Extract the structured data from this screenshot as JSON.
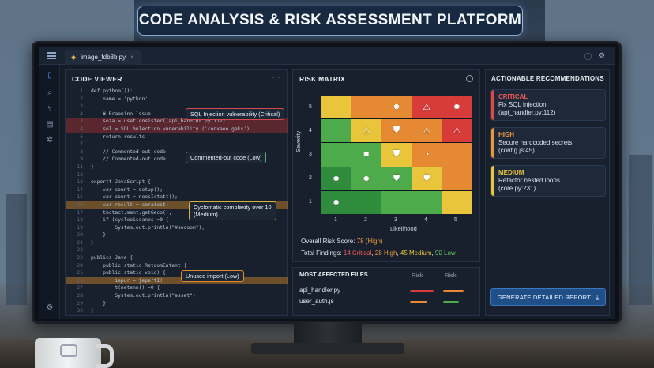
{
  "banner": {
    "title": "CODE ANALYSIS & RISK ASSESSMENT PLATFORM"
  },
  "tabbar": {
    "file_tab": "image_fdb8b.py",
    "close_glyph": "×"
  },
  "icons": {
    "menu": "hamburger-icon",
    "help": "help-icon",
    "settings": "gear-icon",
    "explorer": "file-icon",
    "search": "search-icon",
    "branch": "git-branch-icon",
    "book": "book-icon",
    "debug": "bug-icon",
    "more": "more-dots-icon",
    "download": "download-icon"
  },
  "code_viewer": {
    "title": "CODE VIEWER",
    "more": "···",
    "lines": [
      {
        "n": "1",
        "t": "def pythom()):"
      },
      {
        "n": "2",
        "t": "    name = 'python'"
      },
      {
        "n": "3",
        "t": ""
      },
      {
        "n": "4",
        "t": "    # Braenino lssue"
      },
      {
        "n": "3",
        "t": "    soza = uset.cosister((api_handler.py:112)",
        "hl": "red"
      },
      {
        "n": "4",
        "t": "    sol = SQL hnlection vunerability ('conxaoe gaks')",
        "hl": "red"
      },
      {
        "n": "6",
        "t": "    return results"
      },
      {
        "n": "7",
        "t": ""
      },
      {
        "n": "8",
        "t": "    // Commented-out code"
      },
      {
        "n": "9",
        "t": "    // Commented-out code"
      },
      {
        "n": "11",
        "t": "}"
      },
      {
        "n": "12",
        "t": ""
      },
      {
        "n": "13",
        "t": "exportt JavaScript {"
      },
      {
        "n": "14",
        "t": "    var count = setup();"
      },
      {
        "n": "15",
        "t": "    var count = neesIctatt();"
      },
      {
        "n": "16",
        "t": "    var result = coraiest)",
        "hl": "orange"
      },
      {
        "n": "17",
        "t": "    tnctact.mant.getGeco();"
      },
      {
        "n": "18",
        "t": "    if (cycleeiscanes =0 {"
      },
      {
        "n": "19",
        "t": "        System.out.println(\"#secoom\");"
      },
      {
        "n": "20",
        "t": "    }"
      },
      {
        "n": "21",
        "t": "}"
      },
      {
        "n": "22",
        "t": ""
      },
      {
        "n": "23",
        "t": "publics Java {"
      },
      {
        "n": "24",
        "t": "    public static RetoomEntent {"
      },
      {
        "n": "25",
        "t": "    public static void) {"
      },
      {
        "n": "28",
        "t": "        iepur = jepertI(",
        "hl": "orange"
      },
      {
        "n": "27",
        "t": "        t(netenn() =0 {"
      },
      {
        "n": "28",
        "t": "        System.out.println(\"asset\");"
      },
      {
        "n": "29",
        "t": "    }"
      },
      {
        "n": "30",
        "t": "}"
      }
    ],
    "callouts": {
      "sql": "SQL Injection vulnerability (Critical)",
      "commented": "Commented-out code (Low)",
      "complexity_1": "Cyclomatic complexity over 10",
      "complexity_2": "(Medium)",
      "unused": "Unused import (Low)"
    }
  },
  "risk_matrix": {
    "title": "RISK MATRIX",
    "y_axis": "Severity",
    "x_axis": "Likelihood",
    "y_ticks": [
      "5",
      "4",
      "3",
      "2",
      "1"
    ],
    "x_ticks": [
      "1",
      "2",
      "3",
      "4",
      "5"
    ],
    "score_label": "Overall Risk Score: ",
    "score_value": "78 (High)",
    "findings_label": "Total Findings: ",
    "findings_critical": "14 Critical",
    "findings_high": "28 High",
    "findings_medium": "45 Medium",
    "findings_low": "90 Low",
    "sep": ", "
  },
  "chart_data": {
    "type": "heatmap",
    "title": "RISK MATRIX",
    "xlabel": "Likelihood",
    "ylabel": "Severity",
    "x": [
      1,
      2,
      3,
      4,
      5
    ],
    "y": [
      5,
      4,
      3,
      2,
      1
    ],
    "cells": [
      [
        "yellow",
        "orange",
        "orange",
        "red",
        "red"
      ],
      [
        "green",
        "yellow",
        "orange",
        "orange",
        "red"
      ],
      [
        "green",
        "green",
        "yellow",
        "orange",
        "orange"
      ],
      [
        "dgreen",
        "green",
        "green",
        "yellow",
        "orange"
      ],
      [
        "dgreen",
        "dgreen",
        "green",
        "green",
        "yellow"
      ]
    ],
    "markers": [
      [
        "",
        "",
        "gear",
        "warning",
        "gear"
      ],
      [
        "",
        "warning",
        "shield",
        "warning",
        "warning"
      ],
      [
        "",
        "gear",
        "shield",
        "clock",
        ""
      ],
      [
        "gear",
        "gear",
        "shield",
        "shield",
        ""
      ],
      [
        "gear",
        "",
        "",
        "",
        ""
      ]
    ]
  },
  "files": {
    "title": "MOST AFFECTED FILES",
    "col1": "Risk",
    "col2": "Risk",
    "items": [
      {
        "name": "api_handler.py"
      },
      {
        "name": "user_auth.js"
      }
    ]
  },
  "recommendations": {
    "title": "ACTIONABLE RECOMMENDATIONS",
    "items": [
      {
        "level": "CRITICAL",
        "line1": "Fix SQL Injection",
        "line2": "(api_handler.py:112)"
      },
      {
        "level": "HIGH",
        "line1": "Secure hardcoded secrets",
        "line2": "(config.js:45)"
      },
      {
        "level": "MEDIUM",
        "line1": "Refactor nested loops",
        "line2": "(core.py:231)"
      }
    ],
    "button": "GENERATE DETAILED REPORT"
  },
  "colors": {
    "red": "#d73c3a",
    "orange": "#e58a32",
    "yellow": "#e8c53b",
    "green": "#4eab4b",
    "dgreen": "#2f8c3c",
    "accent": "#1f4f86"
  }
}
